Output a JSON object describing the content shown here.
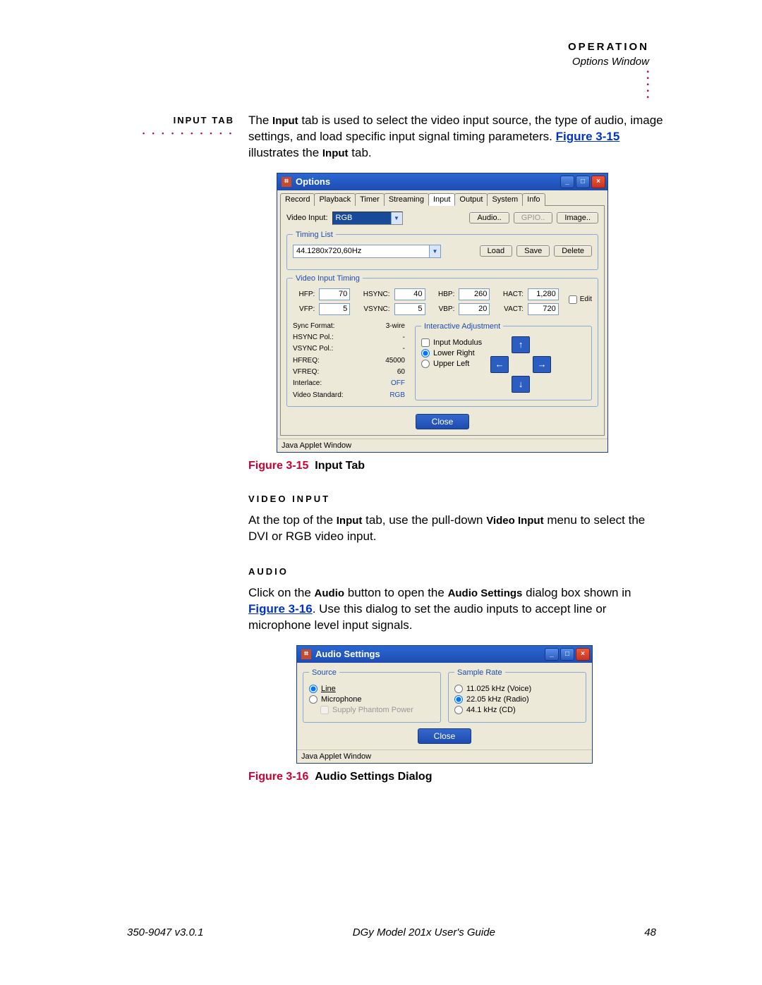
{
  "header": {
    "title": "OPERATION",
    "subtitle": "Options Window"
  },
  "section": {
    "label": "INPUT TAB",
    "para1_a": "The ",
    "para1_b": " tab is used to select the video input source, the type of audio, image settings, and load specific input signal timing parameters. ",
    "input_word": "Input",
    "figref1": "Figure 3-15",
    "para1_c": " illustrates the ",
    "para1_d": " tab."
  },
  "fig1": {
    "num": "Figure 3-15",
    "title": "Input Tab"
  },
  "video_input": {
    "heading": "VIDEO INPUT",
    "p1": "At the top of the ",
    "p2": " tab, use the pull-down ",
    "p3": " menu to select the DVI or RGB video input.",
    "b1": "Input",
    "b2": "Video Input"
  },
  "audio": {
    "heading": "AUDIO",
    "p1": "Click on the ",
    "b1": "Audio",
    "p2": " button to open the ",
    "b2": "Audio Settings",
    "p3": " dialog box shown in ",
    "figref": "Figure 3-16",
    "p4": ". Use this dialog to set the audio inputs to accept line or microphone level input signals."
  },
  "fig2": {
    "num": "Figure 3-16",
    "title": "Audio Settings Dialog"
  },
  "options_win": {
    "title": "Options",
    "tabs": [
      "Record",
      "Playback",
      "Timer",
      "Streaming",
      "Input",
      "Output",
      "System",
      "Info"
    ],
    "video_input_label": "Video Input:",
    "video_input_value": "RGB",
    "btn_audio": "Audio..",
    "btn_gpio": "GPIO..",
    "btn_image": "Image..",
    "timing_list_legend": "Timing List",
    "timing_sel": "44.1280x720,60Hz",
    "btn_load": "Load",
    "btn_save": "Save",
    "btn_delete": "Delete",
    "vit_legend": "Video Input Timing",
    "hfp": "70",
    "hsync": "40",
    "hbp": "260",
    "hact": "1,280",
    "vfp": "5",
    "vsync": "5",
    "vbp": "20",
    "vact": "720",
    "edit": "Edit",
    "sync_format": "3-wire",
    "hsync_pol": "-",
    "vsync_pol": "-",
    "hfreq": "45000",
    "vfreq": "60",
    "interlace": "OFF",
    "video_std": "RGB",
    "ia_legend": "Interactive Adjustment",
    "input_modulus": "Input Modulus",
    "lower_right": "Lower Right",
    "upper_left": "Upper Left",
    "close": "Close",
    "status": "Java Applet Window"
  },
  "audio_win": {
    "title": "Audio Settings",
    "source_legend": "Source",
    "line": "Line",
    "microphone": "Microphone",
    "phantom": "Supply Phantom Power",
    "rate_legend": "Sample Rate",
    "r1": "11.025 kHz (Voice)",
    "r2": "22.05 kHz (Radio)",
    "r3": "44.1 kHz (CD)",
    "close": "Close",
    "status": "Java Applet Window"
  },
  "footer": {
    "left": "350-9047 v3.0.1",
    "center": "DGy Model 201x User's Guide",
    "right": "48"
  }
}
